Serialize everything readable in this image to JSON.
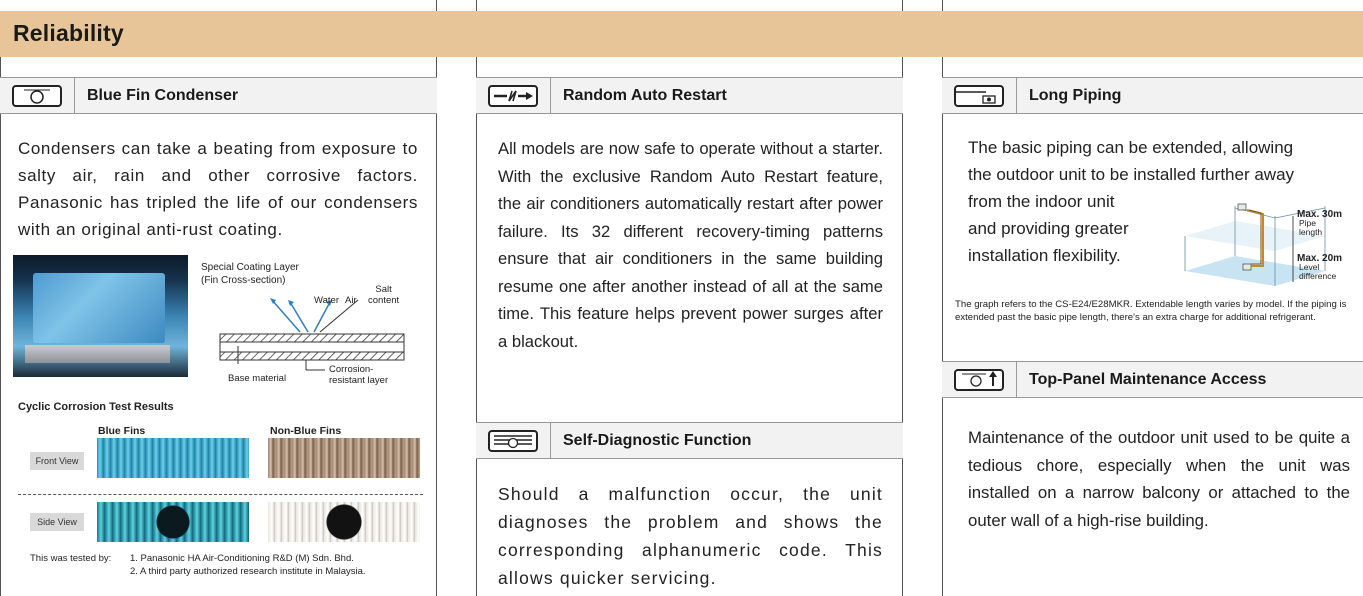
{
  "header": {
    "title": "Reliability"
  },
  "col1": {
    "title": "Blue Fin Condenser",
    "body": "Condensers can take a beating from exposure to salty air, rain and other corrosive factors. Panasonic has tripled the life of our condensers with an original anti-rust coating.",
    "diagram": {
      "title_line1": "Special Coating Layer",
      "title_line2": "(Fin Cross-section)",
      "water": "Water",
      "air": "Air",
      "salt_line1": "Salt",
      "salt_line2": "content",
      "base": "Base material",
      "corrosion_line1": "Corrosion-",
      "corrosion_line2": "resistant layer"
    },
    "test_title": "Cyclic Corrosion Test Results",
    "blue_fins": "Blue Fins",
    "non_blue_fins": "Non-Blue Fins",
    "front_view": "Front View",
    "side_view": "Side View",
    "tested_by": "This was tested by:",
    "tester1": "1. Panasonic HA Air-Conditioning R&D (M) Sdn. Bhd.",
    "tester2": "2. A third party authorized research institute in Malaysia."
  },
  "col2": {
    "title": "Random Auto Restart",
    "body": "All models are now safe to operate without a starter. With the exclusive Random Auto Restart feature, the air conditioners automatically restart after power failure. Its 32 different recovery-timing patterns ensure that air conditioners in the same building resume one after another instead of all at the same time. This feature helps prevent power surges after a blackout.",
    "title2": "Self-Diagnostic Function",
    "body2": "Should a malfunction occur, the unit diagnoses the problem and shows the corresponding alphanumeric code. This allows quicker servicing."
  },
  "col3": {
    "title": "Long Piping",
    "body_line1": "The basic piping can be extended, allowing",
    "body_line2": "the outdoor unit to be installed further away",
    "body_line3": "from the indoor unit",
    "body_line4": "and providing greater",
    "body_line5": "installation flexibility.",
    "max30": "Max. 30m",
    "pipe_line1": "Pipe",
    "pipe_line2": "length",
    "max20": "Max. 20m",
    "level_line1": "Level",
    "level_line2": "difference",
    "note": "The graph refers to the CS-E24/E28MKR. Extendable length varies by model. If the piping is extended past the basic pipe length, there's an extra charge for additional refrigerant.",
    "title2": "Top-Panel Maintenance Access",
    "body2": "Maintenance of the outdoor unit used to be quite a tedious chore, especially when the unit was installed on a narrow balcony or attached to the outer wall of a high-rise building."
  }
}
